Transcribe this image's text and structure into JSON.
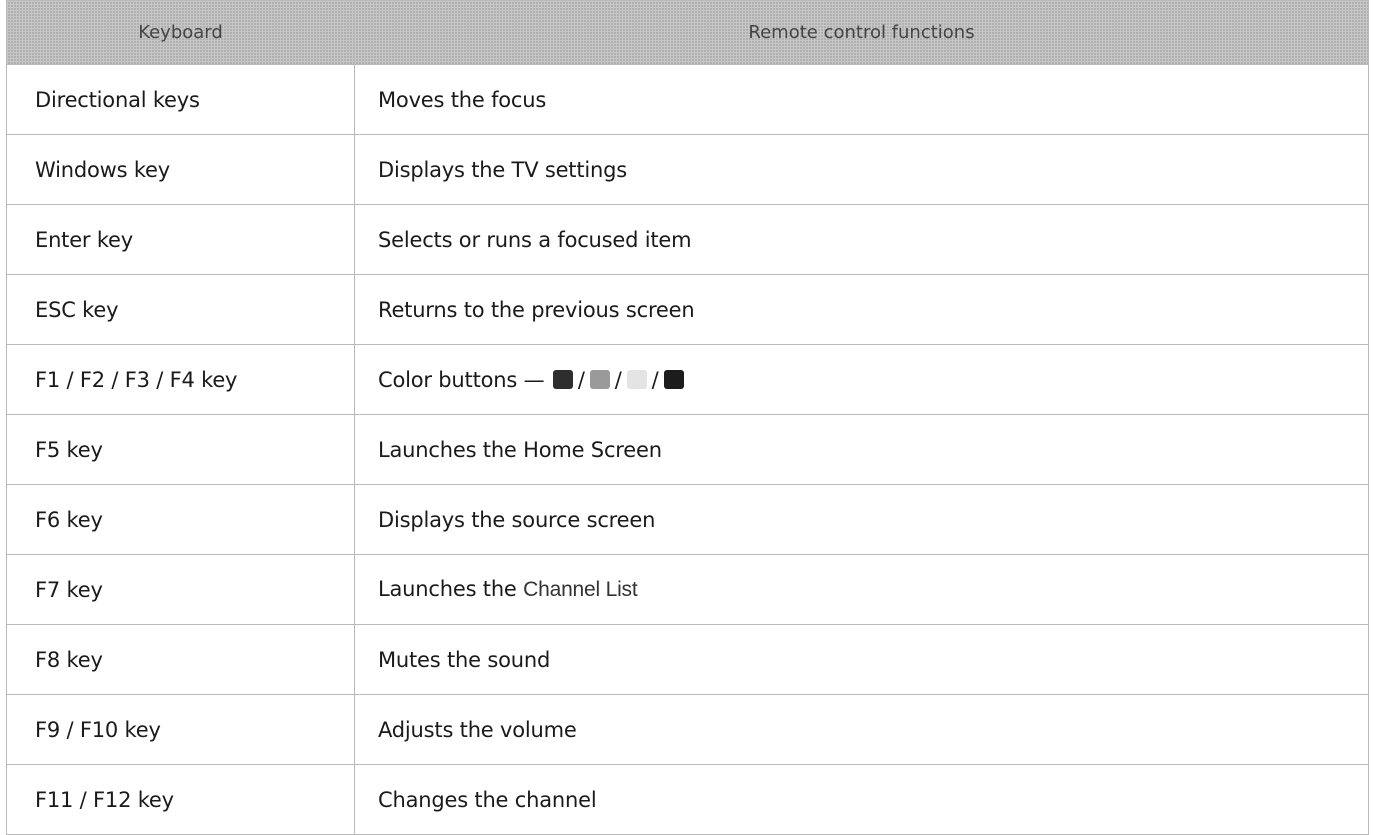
{
  "header": {
    "keyboard_label": "Keyboard",
    "functions_label": "Remote control functions"
  },
  "rows": [
    {
      "key": "Directional keys",
      "function": "Moves the focus"
    },
    {
      "key": "Windows key",
      "function": "Displays the TV settings"
    },
    {
      "key": "Enter key",
      "function": "Selects or runs a focused item"
    },
    {
      "key": "ESC key",
      "function": "Returns to the previous screen"
    },
    {
      "key": "F1 / F2 / F3 / F4 key",
      "function_prefix": "Color buttons —",
      "separator": "/",
      "color_buttons": [
        {
          "name": "red",
          "color": "#2e2e2e"
        },
        {
          "name": "green",
          "color": "#9a9a9a"
        },
        {
          "name": "yellow",
          "color": "#e4e4e4"
        },
        {
          "name": "blue",
          "color": "#1c1c1c"
        }
      ]
    },
    {
      "key": "F5 key",
      "function": "Launches the Home Screen"
    },
    {
      "key": "F6 key",
      "function": "Displays the source screen"
    },
    {
      "key": "F7 key",
      "function_prefix": "Launches the",
      "function_term": "Channel List"
    },
    {
      "key": "F8 key",
      "function": "Mutes the sound"
    },
    {
      "key": "F9 / F10 key",
      "function": "Adjusts the volume"
    },
    {
      "key": "F11 / F12 key",
      "function": "Changes the channel"
    }
  ]
}
